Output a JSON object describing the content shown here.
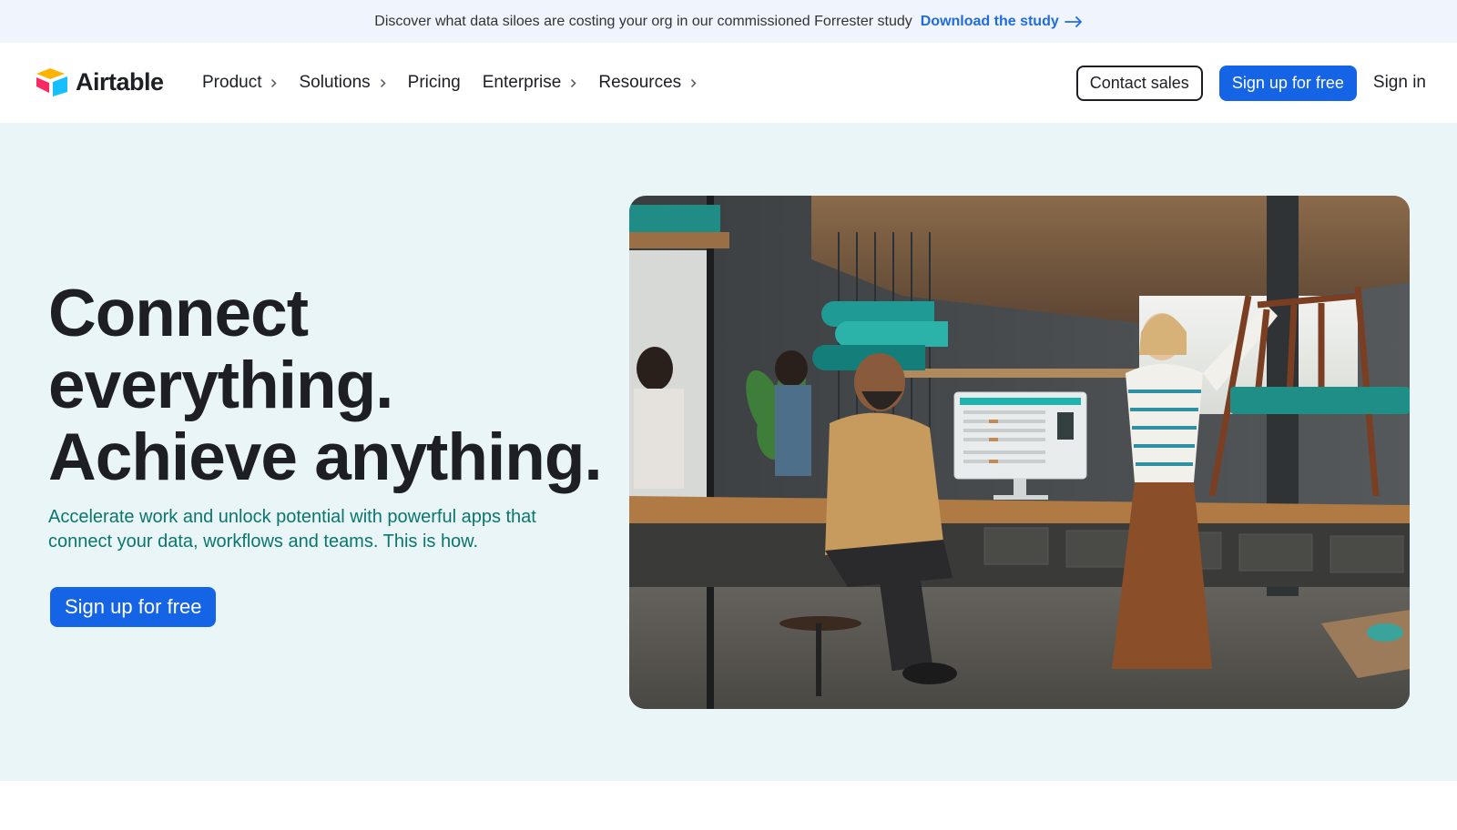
{
  "announcement": {
    "text": "Discover what data siloes are costing your org in our commissioned Forrester study",
    "link_label": "Download the study",
    "link_icon": "arrow-right-icon"
  },
  "header": {
    "brand": "Airtable",
    "nav": [
      {
        "label": "Product",
        "has_chevron": true
      },
      {
        "label": "Solutions",
        "has_chevron": true
      },
      {
        "label": "Pricing",
        "has_chevron": false
      },
      {
        "label": "Enterprise",
        "has_chevron": true
      },
      {
        "label": "Resources",
        "has_chevron": true
      }
    ],
    "contact_sales": "Contact sales",
    "signup": "Sign up for free",
    "signin": "Sign in"
  },
  "hero": {
    "title_lines": [
      "Connect",
      "everything.",
      "Achieve anything."
    ],
    "subtitle": "Accelerate work and unlock potential with powerful apps that connect your data, workflows and teams. This is how.",
    "cta": "Sign up for free"
  },
  "colors": {
    "accent_blue": "#1664e6",
    "link_blue": "#1f6ce0",
    "hero_bg": "#e9f5f6",
    "announce_bg": "#f0f4fd",
    "subtitle_teal": "#0b766e"
  }
}
